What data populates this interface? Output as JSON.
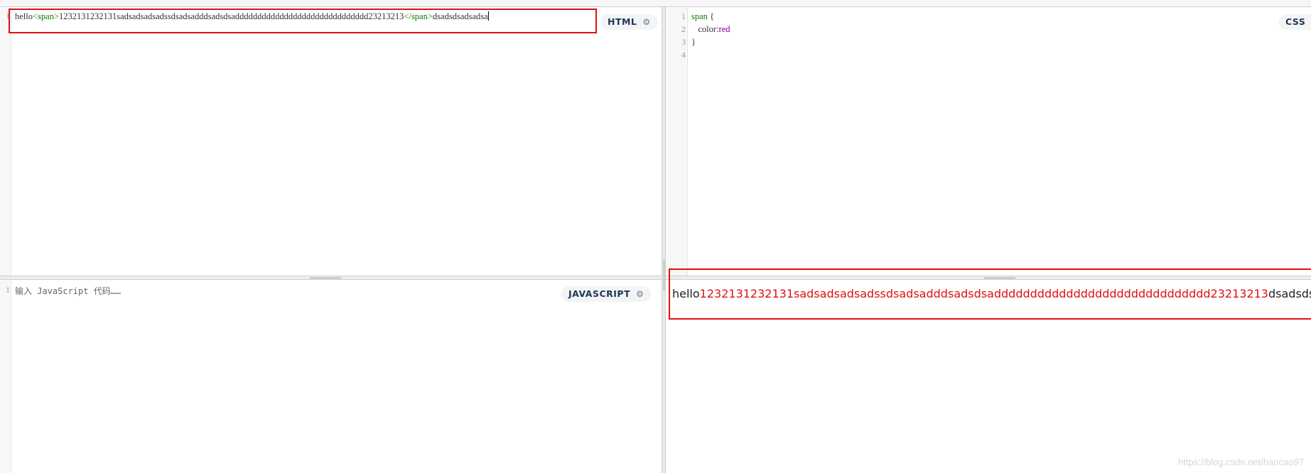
{
  "html_pane": {
    "badge": "HTML",
    "lines": [
      "1"
    ],
    "code": {
      "t1": "hello",
      "t2": "<span>",
      "t3": "1232131232131sadsadsadsadssdsadsadddsadsdsadddddddddddddddddddddddddddddd23213213",
      "t4": "</span>",
      "t5": "dsadsdsadsadsa"
    }
  },
  "css_pane": {
    "badge": "CSS",
    "lines": [
      "1",
      "2",
      "3",
      "4"
    ],
    "code": {
      "l1a": "span",
      "l1b": " {",
      "l2a": "   color:",
      "l2b": "red",
      "l3": "}"
    }
  },
  "js_pane": {
    "badge": "JAVASCRIPT",
    "lines": [
      "1"
    ],
    "placeholder": "输入 JavaScript 代码……"
  },
  "result": {
    "plain_start": "hello",
    "red_text": "1232131232131sadsadsadsadssdsadsadddsadsdsadddddddddddddddddddddddddddddd23213213",
    "plain_end": "dsadsdsadsadsa"
  },
  "watermark": "https://blog.csdn.net/hancao97",
  "icons": {
    "settings": "gear-icon"
  },
  "colors": {
    "highlight": "#e01010",
    "tag": "#117700",
    "atom": "#770088"
  }
}
